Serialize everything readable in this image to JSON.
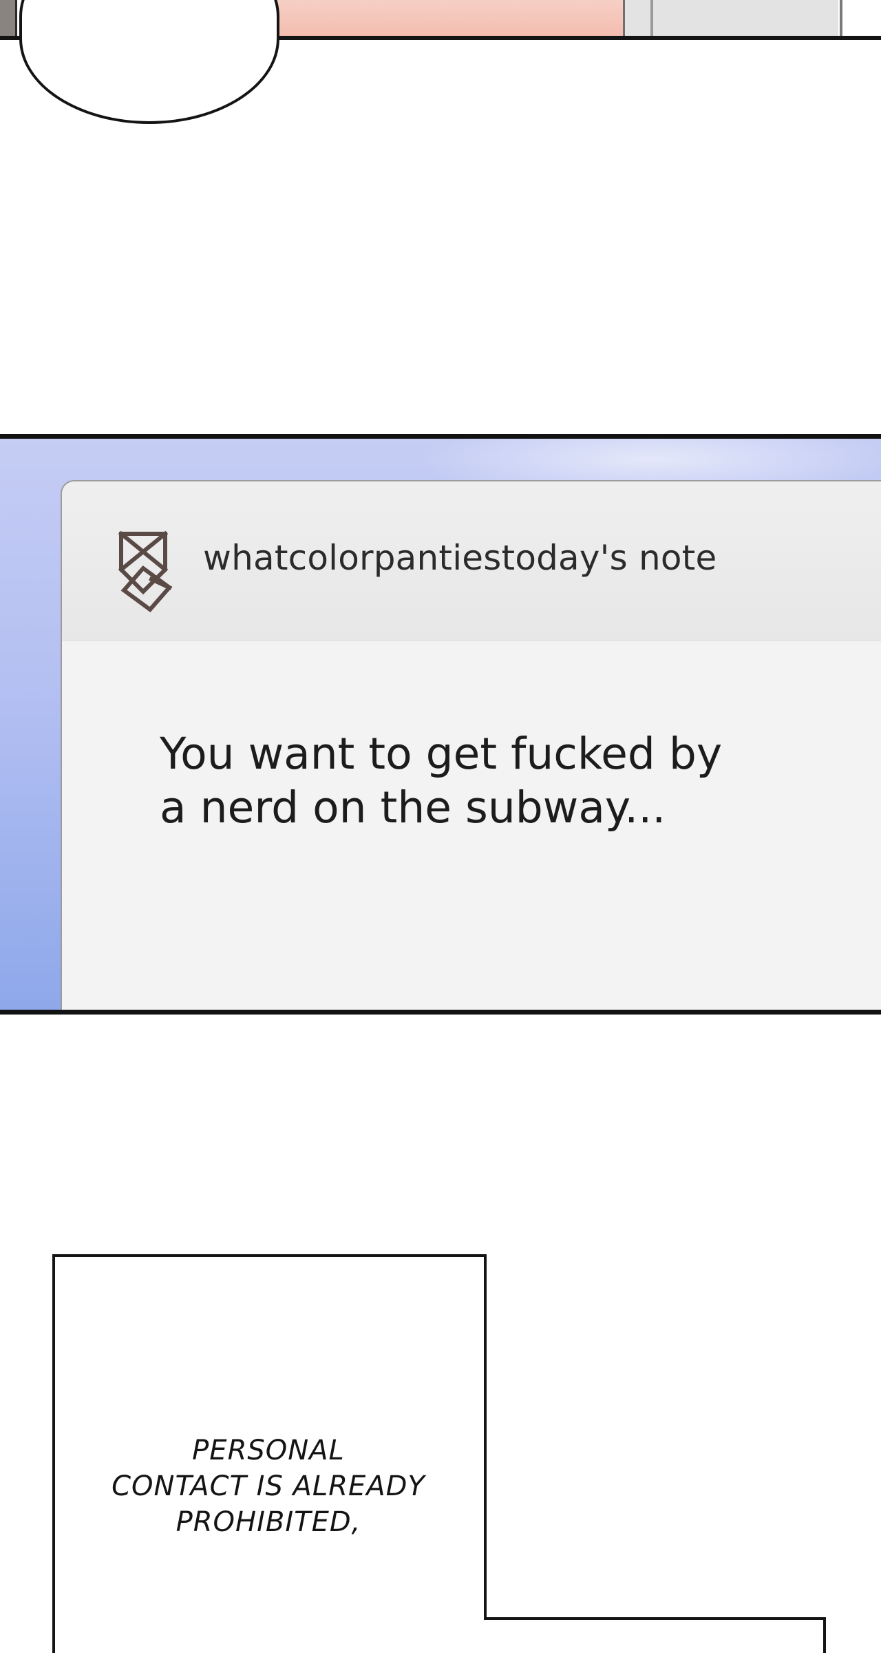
{
  "note": {
    "title": "whatcolorpantiestoday's note",
    "icon": "envelope-note-icon",
    "body_lines": [
      "You want to get fucked by",
      "a nerd on the subway..."
    ]
  },
  "caption": {
    "lines": [
      "PERSONAL",
      "CONTACT IS ALREADY",
      "PROHIBITED,"
    ]
  },
  "colors": {
    "panel_border": "#121212",
    "sky": "#b3bff2",
    "card_bg": "#f3f3f3",
    "header_bg": "#e8e7e7",
    "icon_stroke": "#5a4a46",
    "text": "#1c1c1c"
  }
}
